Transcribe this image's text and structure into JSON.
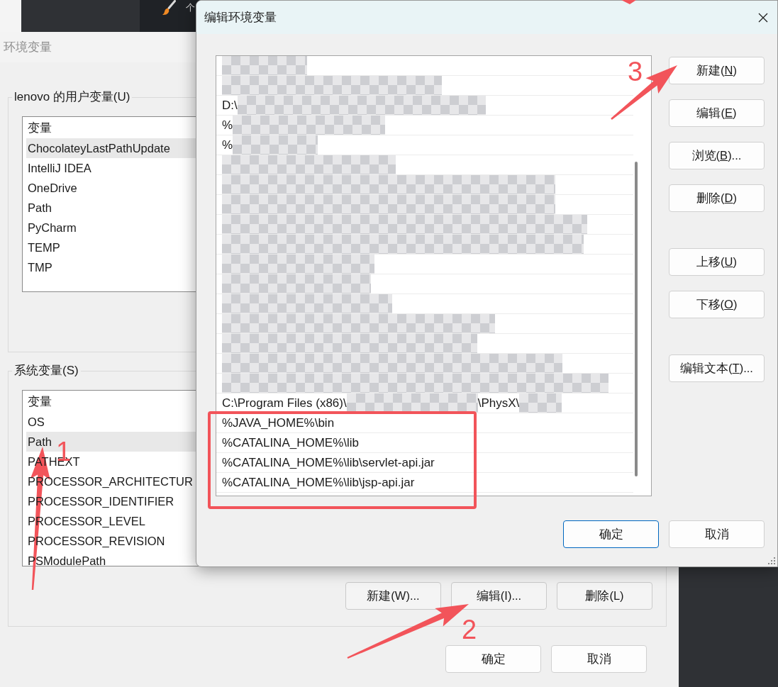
{
  "desktop": {
    "toolbar_text": "个"
  },
  "env_window": {
    "title": "环境变量",
    "user_vars": {
      "label": "lenovo 的用户变量(U)",
      "header": "变量",
      "rows": [
        {
          "name": "ChocolateyLastPathUpdate",
          "selected": true
        },
        {
          "name": "IntelliJ IDEA",
          "selected": false
        },
        {
          "name": "OneDrive",
          "selected": false
        },
        {
          "name": "Path",
          "selected": false
        },
        {
          "name": "PyCharm",
          "selected": false
        },
        {
          "name": "TEMP",
          "selected": false
        },
        {
          "name": "TMP",
          "selected": false
        }
      ]
    },
    "system_vars": {
      "label": "系统变量(S)",
      "header": "变量",
      "rows": [
        {
          "name": "OS",
          "selected": false
        },
        {
          "name": "Path",
          "selected": true
        },
        {
          "name": "PATHEXT",
          "selected": false
        },
        {
          "name": "PROCESSOR_ARCHITECTUR",
          "selected": false
        },
        {
          "name": "PROCESSOR_IDENTIFIER",
          "selected": false
        },
        {
          "name": "PROCESSOR_LEVEL",
          "selected": false
        },
        {
          "name": "PROCESSOR_REVISION",
          "selected": false
        },
        {
          "name": "PSModulePath",
          "selected": false
        }
      ],
      "buttons": [
        "新建(W)...",
        "编辑(I)...",
        "删除(L)"
      ]
    },
    "buttons": [
      "确定",
      "取消"
    ]
  },
  "edit_dialog": {
    "title": "编辑环境变量",
    "entries": [
      {
        "parts": [
          {
            "kind": "mosaic"
          }
        ],
        "selected": false
      },
      {
        "parts": [
          {
            "kind": "mosaic"
          }
        ],
        "selected": false
      },
      {
        "parts": [
          {
            "kind": "text",
            "text": "D:\\"
          },
          {
            "kind": "mosaic"
          }
        ],
        "selected": false
      },
      {
        "parts": [
          {
            "kind": "text",
            "text": "%"
          },
          {
            "kind": "mosaic"
          }
        ],
        "selected": false
      },
      {
        "parts": [
          {
            "kind": "text",
            "text": "%"
          },
          {
            "kind": "mosaic"
          }
        ],
        "selected": false
      },
      {
        "parts": [
          {
            "kind": "mosaic"
          }
        ],
        "selected": false
      },
      {
        "parts": [
          {
            "kind": "mosaic"
          }
        ],
        "selected": false
      },
      {
        "parts": [
          {
            "kind": "mosaic"
          }
        ],
        "selected": false
      },
      {
        "parts": [
          {
            "kind": "mosaic"
          }
        ],
        "selected": false
      },
      {
        "parts": [
          {
            "kind": "mosaic"
          }
        ],
        "selected": false
      },
      {
        "parts": [
          {
            "kind": "mosaic"
          }
        ],
        "selected": false
      },
      {
        "parts": [
          {
            "kind": "mosaic"
          }
        ],
        "selected": false
      },
      {
        "parts": [
          {
            "kind": "mosaic"
          }
        ],
        "selected": false
      },
      {
        "parts": [
          {
            "kind": "mosaic"
          }
        ],
        "selected": false
      },
      {
        "parts": [
          {
            "kind": "mosaic"
          }
        ],
        "selected": false
      },
      {
        "parts": [
          {
            "kind": "mosaic"
          }
        ],
        "selected": false
      },
      {
        "parts": [
          {
            "kind": "mosaic"
          }
        ],
        "selected": false
      },
      {
        "parts": [
          {
            "kind": "text",
            "text": "C:\\Program Files (x86)\\"
          },
          {
            "kind": "mosaic"
          },
          {
            "kind": "text",
            "text": "\\PhysX\\"
          },
          {
            "kind": "mosaic"
          }
        ],
        "selected": false
      },
      {
        "parts": [
          {
            "kind": "text",
            "text": "%JAVA_HOME%\\bin"
          }
        ],
        "selected": false
      },
      {
        "parts": [
          {
            "kind": "text",
            "text": "%CATALINA_HOME%\\lib"
          }
        ],
        "selected": false
      },
      {
        "parts": [
          {
            "kind": "text",
            "text": "%CATALINA_HOME%\\lib\\servlet-api.jar"
          }
        ],
        "selected": false
      },
      {
        "parts": [
          {
            "kind": "text",
            "text": "%CATALINA_HOME%\\lib\\jsp-api.jar"
          }
        ],
        "selected": false
      }
    ],
    "side_buttons": [
      {
        "before": "新建(",
        "key": "N",
        "after": ")"
      },
      {
        "before": "编辑(",
        "key": "E",
        "after": ")"
      },
      {
        "before": "浏览(",
        "key": "B",
        "after": ")..."
      },
      {
        "before": "删除(",
        "key": "D",
        "after": ")"
      },
      {
        "before": "上移(",
        "key": "U",
        "after": ")"
      },
      {
        "before": "下移(",
        "key": "O",
        "after": ")"
      },
      {
        "before": "编辑文本(",
        "key": "T",
        "after": ")..."
      }
    ],
    "buttons": [
      {
        "label": "确定",
        "default": true
      },
      {
        "label": "取消",
        "default": false
      }
    ]
  },
  "annotations": [
    {
      "kind": "frame"
    },
    {
      "kind": "arrow",
      "number": "1"
    },
    {
      "kind": "arrow",
      "number": "2"
    },
    {
      "kind": "arrow",
      "number": "3"
    },
    {
      "kind": "arrow"
    }
  ]
}
